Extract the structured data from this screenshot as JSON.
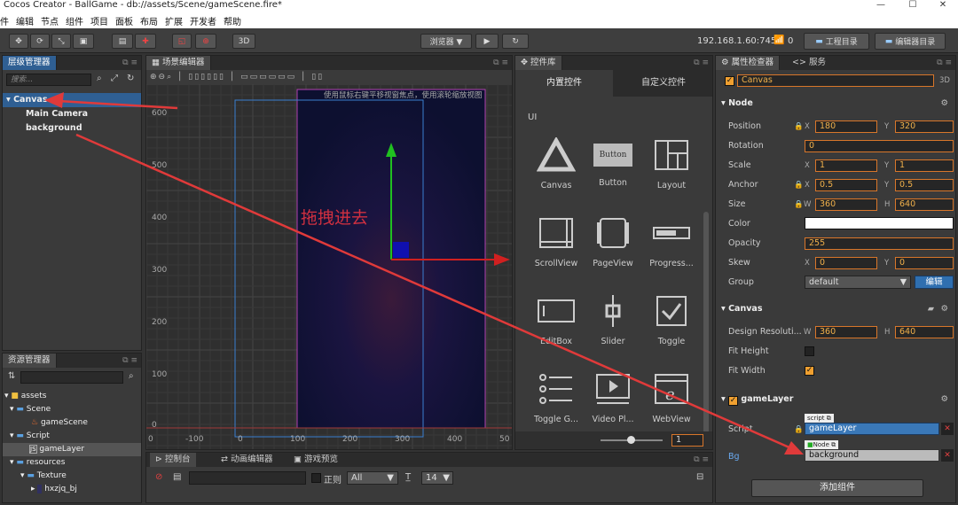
{
  "window": {
    "title": "Cocos Creator - BallGame - db://assets/Scene/gameScene.fire*"
  },
  "menu": [
    "件",
    "编辑",
    "节点",
    "组件",
    "项目",
    "面板",
    "布局",
    "扩展",
    "开发者",
    "帮助"
  ],
  "toolbar": {
    "mode_3d": "3D",
    "browser": "浏览器 ▼",
    "ip": "192.168.1.60:7456",
    "wifi_count": "0",
    "project_dir": "工程目录",
    "editor_dir": "编辑器目录"
  },
  "hierarchy": {
    "tab": "层级管理器",
    "search_placeholder": "搜索...",
    "items": [
      "Canvas",
      "Main Camera",
      "background"
    ]
  },
  "assets": {
    "tab": "资源管理器",
    "items": [
      "assets",
      "Scene",
      "gameScene",
      "Script",
      "gameLayer",
      "resources",
      "Texture",
      "hxzjq_bj"
    ]
  },
  "scene": {
    "tab": "场景编辑器",
    "hint": "使用鼠标右键平移视窗焦点，使用滚轮缩放视图",
    "annotation": "拖拽进去",
    "y_ticks": [
      "600",
      "500",
      "400",
      "300",
      "200",
      "100",
      "0"
    ],
    "x_ticks": [
      "0",
      "-100",
      "0",
      "100",
      "200",
      "300",
      "400",
      "50"
    ]
  },
  "console": {
    "tabs": [
      "控制台",
      "动画编辑器",
      "游戏预览"
    ],
    "regex": "正则",
    "filter": "All",
    "font_size": "14"
  },
  "library": {
    "tab": "控件库",
    "subtabs": [
      "内置控件",
      "自定义控件"
    ],
    "section": "UI",
    "widgets": [
      "Canvas",
      "Button",
      "Layout",
      "ScrollView",
      "PageView",
      "Progress...",
      "EditBox",
      "Slider",
      "Toggle",
      "Toggle G...",
      "Video Pl...",
      "WebView"
    ],
    "button_text": "Button",
    "zoom": "1"
  },
  "inspector": {
    "tabs": [
      "属性检查器",
      "服务"
    ],
    "node_name": "Canvas",
    "dim": "3D",
    "node_section": "Node",
    "rows": {
      "position": {
        "label": "Position",
        "x": "180",
        "y": "320"
      },
      "rotation": {
        "label": "Rotation",
        "v": "0"
      },
      "scale": {
        "label": "Scale",
        "x": "1",
        "y": "1"
      },
      "anchor": {
        "label": "Anchor",
        "x": "0.5",
        "y": "0.5"
      },
      "size": {
        "label": "Size",
        "w": "360",
        "h": "640"
      },
      "color": {
        "label": "Color"
      },
      "opacity": {
        "label": "Opacity",
        "v": "255"
      },
      "skew": {
        "label": "Skew",
        "x": "0",
        "y": "0"
      },
      "group": {
        "label": "Group",
        "v": "default",
        "btn": "编辑"
      }
    },
    "canvas_section": "Canvas",
    "design": {
      "label": "Design Resoluti...",
      "w": "360",
      "h": "640"
    },
    "fit_height": "Fit Height",
    "fit_width": "Fit Width",
    "gamelayer_section": "gameLayer",
    "script": {
      "label": "Script",
      "tag": "script",
      "value": "gameLayer"
    },
    "bg": {
      "label": "Bg",
      "tag": "Node",
      "value": "background"
    },
    "add_component": "添加组件"
  },
  "axis_letters": {
    "x": "X",
    "y": "Y",
    "w": "W",
    "h": "H"
  },
  "colors": {
    "accent": "#2f5f93",
    "orange": "#f0a030",
    "arrow": "#e03a3a"
  }
}
